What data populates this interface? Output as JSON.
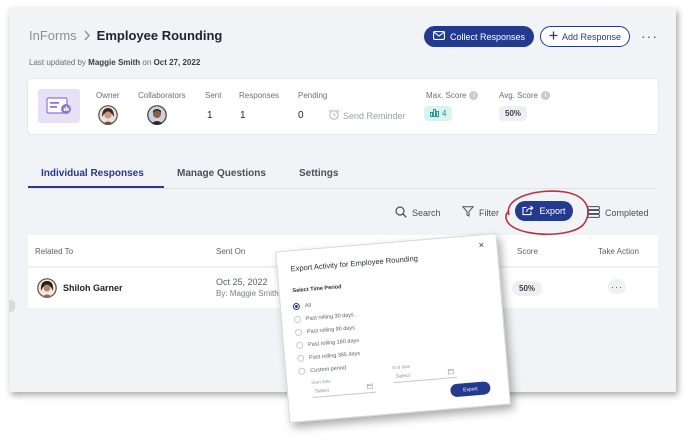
{
  "header": {
    "app_name": "InForms",
    "title": "Employee Rounding",
    "updated_prefix": "Last updated by",
    "updated_user": "Maggie Smith",
    "updated_on": "on",
    "updated_date": "Oct 27, 2022",
    "collect_label": "Collect Responses",
    "add_label": "Add Response",
    "more_label": "···"
  },
  "stats": {
    "owner_label": "Owner",
    "collaborators_label": "Collaborators",
    "sent_label": "Sent",
    "sent_value": "1",
    "responses_label": "Responses",
    "responses_value": "1",
    "pending_label": "Pending",
    "pending_value": "0",
    "reminder_label": "Send Reminder",
    "max_score_label": "Max. Score",
    "max_score_value": "4",
    "avg_score_label": "Avg. Score",
    "avg_score_value": "50%"
  },
  "tabs": [
    {
      "label": "Individual Responses",
      "active": true
    },
    {
      "label": "Manage Questions",
      "active": false
    },
    {
      "label": "Settings",
      "active": false
    }
  ],
  "toolbar": {
    "search_label": "Search",
    "filter_label": "Filter",
    "export_label": "Export",
    "completed_label": "Completed"
  },
  "table": {
    "columns": [
      "Related To",
      "Sent On",
      "Score",
      "Take Action"
    ],
    "rows": [
      {
        "name": "Shiloh Garner",
        "sent_on": "Oct 25, 2022",
        "sent_by": "By: Maggie Smith",
        "score": "50%",
        "action": "···"
      }
    ]
  },
  "modal": {
    "title": "Export Activity for Employee Rounding",
    "close": "×",
    "section_label": "Select Time Period",
    "options": [
      "All",
      "Past rolling 30 days",
      "Past rolling 90 days",
      "Past rolling 180 days",
      "Past rolling 365 days",
      "Custom period"
    ],
    "selected_index": 0,
    "start_label": "Start date",
    "start_placeholder": "Select",
    "end_label": "End date",
    "end_placeholder": "Select",
    "export_label": "Export"
  },
  "colors": {
    "primary": "#243a8f",
    "highlight_circle": "#b8333f",
    "max_score_bg": "#d9f3f0",
    "form_tile_bg": "#e6e1f6"
  }
}
